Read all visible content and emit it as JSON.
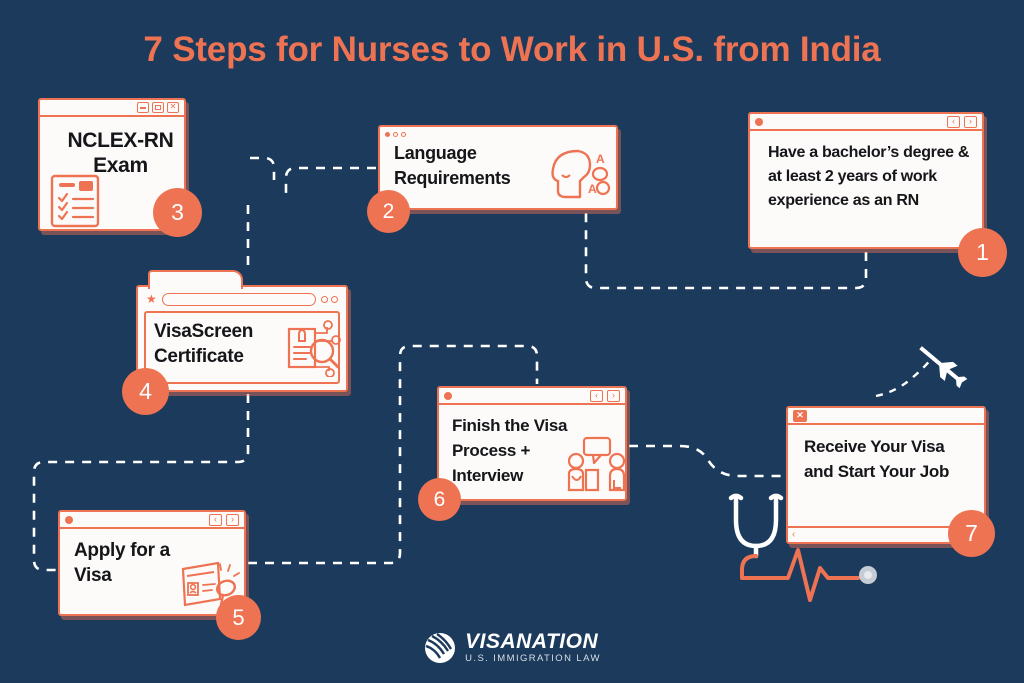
{
  "page": {
    "title": "7 Steps for Nurses to Work in U.S. from India",
    "background_color": "#1b3a5c",
    "accent_color": "#ed7353",
    "card_color": "#fdfbf9",
    "text_color": "#15161a",
    "connector_color": "#ffffff"
  },
  "steps": [
    {
      "number": "1",
      "text": "Have a bachelor’s degree & at least 2 years of work experience as an RN",
      "window_style": "dot-left-navs-right",
      "icon": null
    },
    {
      "number": "2",
      "text": "Language Requirements",
      "window_style": "three-dots-left",
      "icon": "speaking-head-icon"
    },
    {
      "number": "3",
      "text": "NCLEX-RN Exam",
      "window_style": "window-buttons-right",
      "icon": "checklist-clipboard-icon"
    },
    {
      "number": "4",
      "text": "VisaScreen Certificate",
      "window_style": "browser-tab-with-urlbar",
      "icon": "id-card-magnifier-icon"
    },
    {
      "number": "5",
      "text": "Apply for a Visa",
      "window_style": "dot-left-navs-right",
      "icon": "visa-document-stamp-icon"
    },
    {
      "number": "6",
      "text": "Finish the Visa Process + Interview",
      "window_style": "dot-left-navs-right",
      "icon": "interview-people-icon"
    },
    {
      "number": "7",
      "text": "Receive Your Visa and Start Your Job",
      "window_style": "close-x-left-scrollbar-bottom",
      "icon": null
    }
  ],
  "decorations": [
    {
      "name": "airplane-icon",
      "color": "#ffffff"
    },
    {
      "name": "stethoscope-icon",
      "color": "#ffffff"
    },
    {
      "name": "heartbeat-line",
      "color": "#ed7353"
    }
  ],
  "logo": {
    "icon": "globe-icon",
    "name": "VISANATION",
    "tagline": "U.S. IMMIGRATION LAW"
  }
}
